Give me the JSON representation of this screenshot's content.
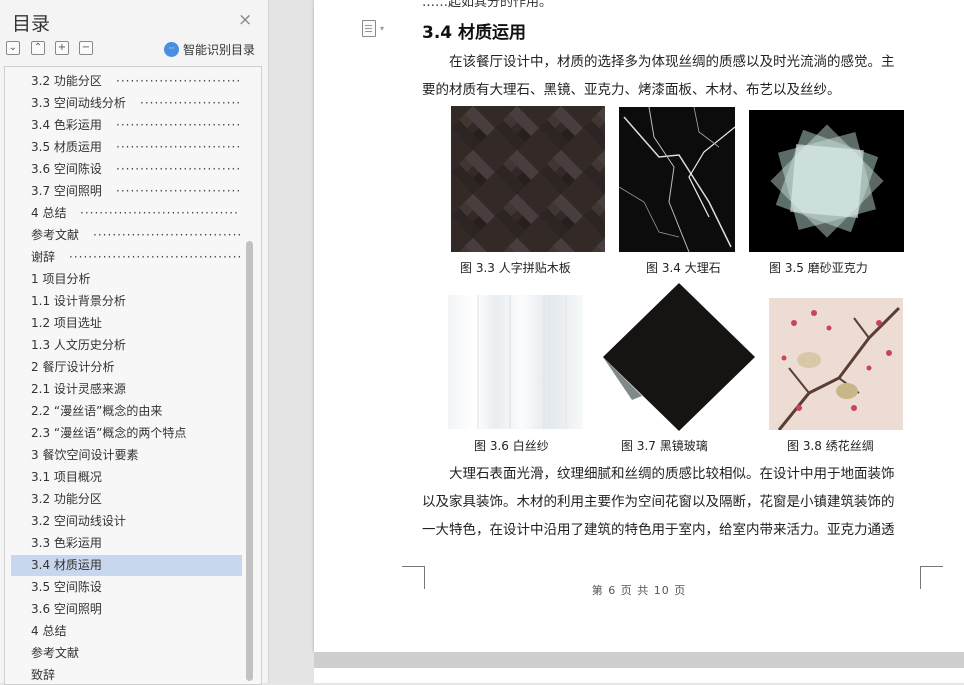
{
  "toc_panel": {
    "title": "目录",
    "close_glyph": "×",
    "smart_toc_label": "智能识别目录",
    "items": [
      {
        "label": "3.2 功能分区",
        "dots": true
      },
      {
        "label": "3.3 空间动线分析",
        "dots": true
      },
      {
        "label": "3.4 色彩运用",
        "dots": true
      },
      {
        "label": "3.5 材质运用",
        "dots": true
      },
      {
        "label": "3.6 空间陈设",
        "dots": true
      },
      {
        "label": "3.7 空间照明",
        "dots": true
      },
      {
        "label": "4 总结",
        "dots": true
      },
      {
        "label": "参考文献",
        "dots": true
      },
      {
        "label": "谢辞",
        "dots": true
      },
      {
        "label": "1 项目分析",
        "dots": false
      },
      {
        "label": "1.1 设计背景分析",
        "dots": false
      },
      {
        "label": "1.2 项目选址",
        "dots": false
      },
      {
        "label": "1.3 人文历史分析",
        "dots": false
      },
      {
        "label": "2 餐厅设计分析",
        "dots": false
      },
      {
        "label": "2.1 设计灵感来源",
        "dots": false
      },
      {
        "label": "2.2 “漫丝语”概念的由来",
        "dots": false
      },
      {
        "label": "2.3 “漫丝语”概念的两个特点",
        "dots": false
      },
      {
        "label": "3 餐饮空间设计要素",
        "dots": false
      },
      {
        "label": "3.1 项目概况",
        "dots": false
      },
      {
        "label": "3.2 功能分区",
        "dots": false
      },
      {
        "label": "3.2 空间动线设计",
        "dots": false
      },
      {
        "label": "3.3 色彩运用",
        "dots": false
      },
      {
        "label": "3.4 材质运用",
        "dots": false,
        "active": true
      },
      {
        "label": "3.5 空间陈设",
        "dots": false
      },
      {
        "label": "3.6 空间照明",
        "dots": false
      },
      {
        "label": "4 总结",
        "dots": false
      },
      {
        "label": "参考文献",
        "dots": false
      },
      {
        "label": "致辞",
        "dots": false
      }
    ]
  },
  "document": {
    "top_cut_text": "……起如其分的作用。",
    "heading": "3.4 材质运用",
    "para1": [
      "在该餐厅设计中，材质的选择多为体现丝绸的质感以及时光流淌的感觉。主",
      "要的材质有大理石、黑镜、亚克力、烤漆面板、木材、布艺以及丝纱。"
    ],
    "figures": [
      {
        "caption": "图 3.3 人字拼贴木板"
      },
      {
        "caption": "图 3.4  大理石"
      },
      {
        "caption": "图 3.5  磨砂亚克力"
      },
      {
        "caption": "图 3.6  白丝纱"
      },
      {
        "caption": "图 3.7  黑镜玻璃"
      },
      {
        "caption": "图 3.8  绣花丝绸"
      }
    ],
    "para2": [
      "大理石表面光滑，纹理细腻和丝绸的质感比较相似。在设计中用于地面装饰",
      "以及家具装饰。木材的利用主要作为空间花窗以及隔断，花窗是小镇建筑装饰的",
      "一大特色，在设计中沿用了建筑的特色用于室内，给室内带来活力。亚克力通透"
    ],
    "footer": "第 6 页 共 10 页"
  },
  "colors": {
    "active_item_bg": "#c9d7ee",
    "accent_blue": "#4a8ee0"
  }
}
